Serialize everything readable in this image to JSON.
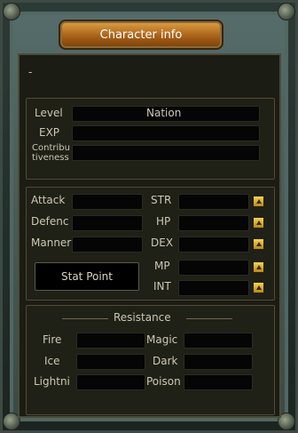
{
  "window": {
    "title": "Character info"
  },
  "header": {
    "name": "-"
  },
  "info": {
    "level_label": "Level",
    "nation_label": "Nation",
    "exp_label": "EXP",
    "contribution_label": "Contribu tiveness"
  },
  "combat": {
    "attack_label": "Attack",
    "defence_label": "Defenc",
    "manner_label": "Manner",
    "stat_point_label": "Stat Point"
  },
  "stats": {
    "str_label": "STR",
    "hp_label": "HP",
    "dex_label": "DEX",
    "mp_label": "MP",
    "int_label": "INT"
  },
  "resistance": {
    "title": "Resistance",
    "fire_label": "Fire",
    "magic_label": "Magic",
    "ice_label": "Ice",
    "dark_label": "Dark",
    "lightning_label": "Lightni",
    "poison_label": "Poison"
  },
  "icons": {
    "plus": "increase-stat-icon",
    "corner": "corner-orb-icon"
  },
  "colors": {
    "title_plate": "#c07a24",
    "panel_bg": "#1b1c13",
    "plus_button": "#f0c83a"
  }
}
